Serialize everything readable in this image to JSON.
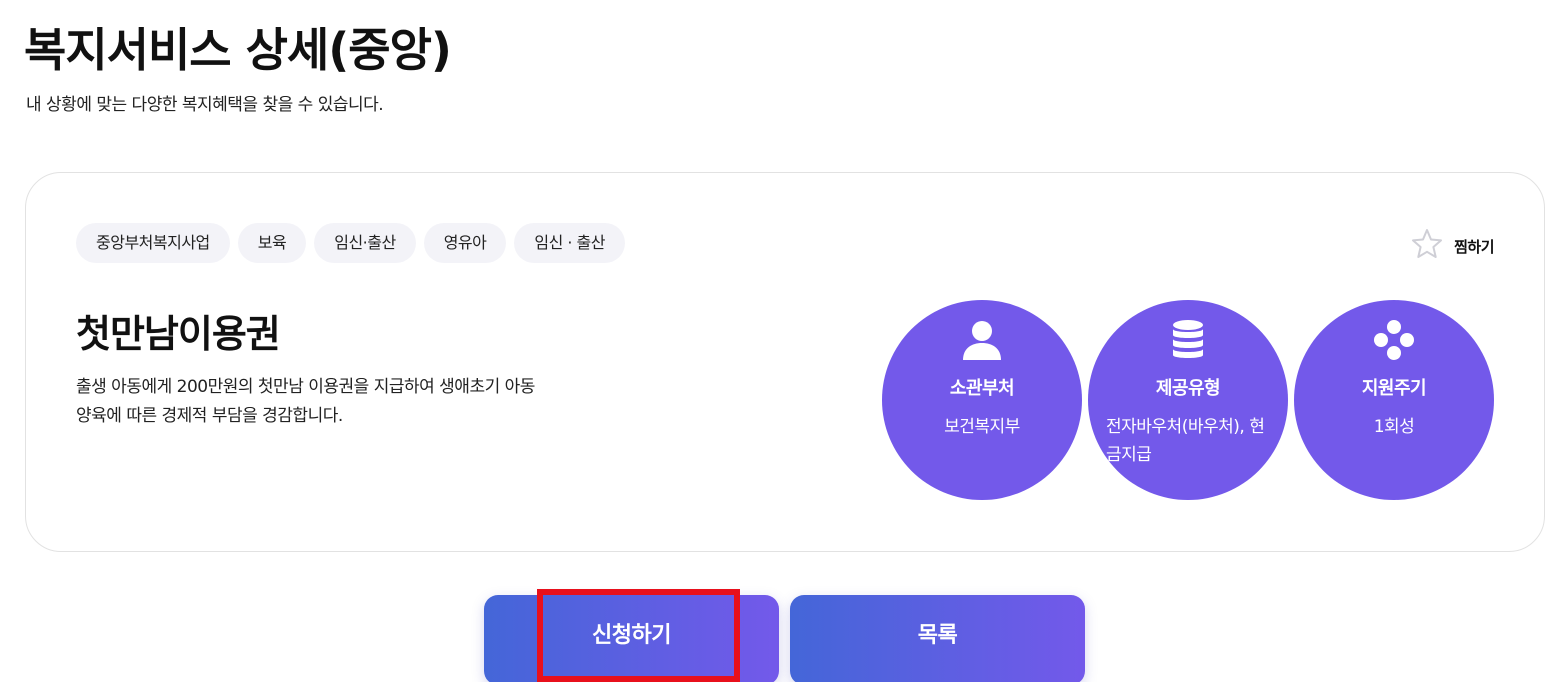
{
  "header": {
    "title": "복지서비스 상세(중앙)",
    "subtitle": "내 상황에 맞는 다양한 복지혜택을 찾을 수 있습니다."
  },
  "card": {
    "tags": [
      "중앙부처복지사업",
      "보육",
      "임신·출산",
      "영유아",
      "임신 · 출산"
    ],
    "favorite_label": "찜하기",
    "favorite_icon": "star-outline-icon",
    "service_name": "첫만남이용권",
    "description": "출생 아동에게 200만원의 첫만남 이용권을 지급하여 생애초기 아동양육에 따른 경제적 부담을 경감합니다.",
    "info": [
      {
        "icon": "person-icon",
        "label": "소관부처",
        "value": "보건복지부"
      },
      {
        "icon": "coin-stack-icon",
        "label": "제공유형",
        "value": "전자바우처(바우처), 현금지급"
      },
      {
        "icon": "four-dots-icon",
        "label": "지원주기",
        "value": "1회성"
      }
    ]
  },
  "actions": {
    "apply_label": "신청하기",
    "list_label": "목록"
  },
  "colors": {
    "accent": "#7359ea",
    "gradient_start": "#4466d8",
    "highlight": "#e8101c",
    "tag_bg": "#f3f3f8"
  }
}
